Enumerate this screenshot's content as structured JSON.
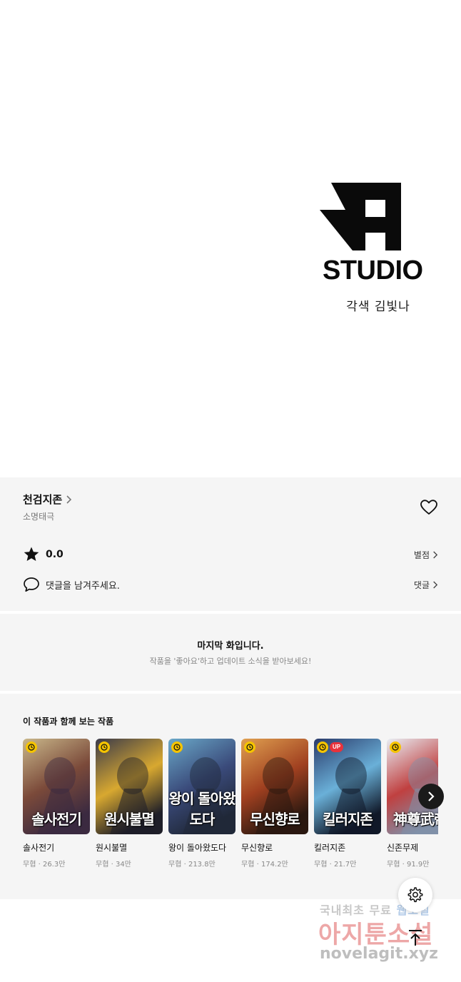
{
  "credits": {
    "studio_name": "STUDIO",
    "credit_line": "각색 김빛나"
  },
  "work": {
    "title": "천검지존",
    "genre_tag": "소명태극",
    "rating_value": "0.0",
    "rating_link": "별점",
    "comment_prompt": "댓글을 남겨주세요.",
    "comment_link": "댓글"
  },
  "last_episode": {
    "title": "마지막 화입니다.",
    "subtitle": "작품을 '좋아요'하고 업데이트 소식을 받아보세요!"
  },
  "recommendations": {
    "heading": "이 작품과 함께 보는 작품",
    "items": [
      {
        "name": "솔사전기",
        "genre": "무협",
        "views": "26.3만",
        "cover_text": "솔사전기",
        "badge_up": false,
        "palette": [
          "#c9b78a",
          "#7b4a3a",
          "#3b2a40"
        ]
      },
      {
        "name": "원시불멸",
        "genre": "무협",
        "views": "34만",
        "cover_text": "원시불멸",
        "badge_up": false,
        "palette": [
          "#3a3a4a",
          "#d8a830",
          "#1e1e28"
        ]
      },
      {
        "name": "왕이 돌아왔도다",
        "genre": "무협",
        "views": "213.8만",
        "cover_text": "왕이 돌아왔도다",
        "badge_up": false,
        "palette": [
          "#6aa8c8",
          "#3a4a7a",
          "#202838"
        ]
      },
      {
        "name": "무신향로",
        "genre": "무협",
        "views": "174.2만",
        "cover_text": "무신향로",
        "badge_up": false,
        "palette": [
          "#e0a050",
          "#a04020",
          "#2a1810"
        ]
      },
      {
        "name": "킬러지존",
        "genre": "무협",
        "views": "21.7만",
        "cover_text": "킬러지존",
        "badge_up": true,
        "up_label": "UP",
        "palette": [
          "#2a3a6a",
          "#6ab0d8",
          "#101828"
        ]
      },
      {
        "name": "신존무제",
        "genre": "무협",
        "views": "91.9만",
        "cover_text": "神尊武帝",
        "badge_up": false,
        "palette": [
          "#e8eef4",
          "#c04040",
          "#8090a8"
        ]
      }
    ]
  },
  "watermark": {
    "line1_a": "국내최초 무료",
    "line1_b": "웹소설",
    "line2": "아지툰소설",
    "line3": "novelagit.xyz"
  },
  "icons": {
    "heart": "heart-outline-icon",
    "star": "star-filled-icon",
    "comment": "speech-bubble-icon",
    "next": "chevron-right-icon",
    "settings": "gear-icon",
    "top": "arrow-up-icon",
    "clock": "clock-icon"
  }
}
